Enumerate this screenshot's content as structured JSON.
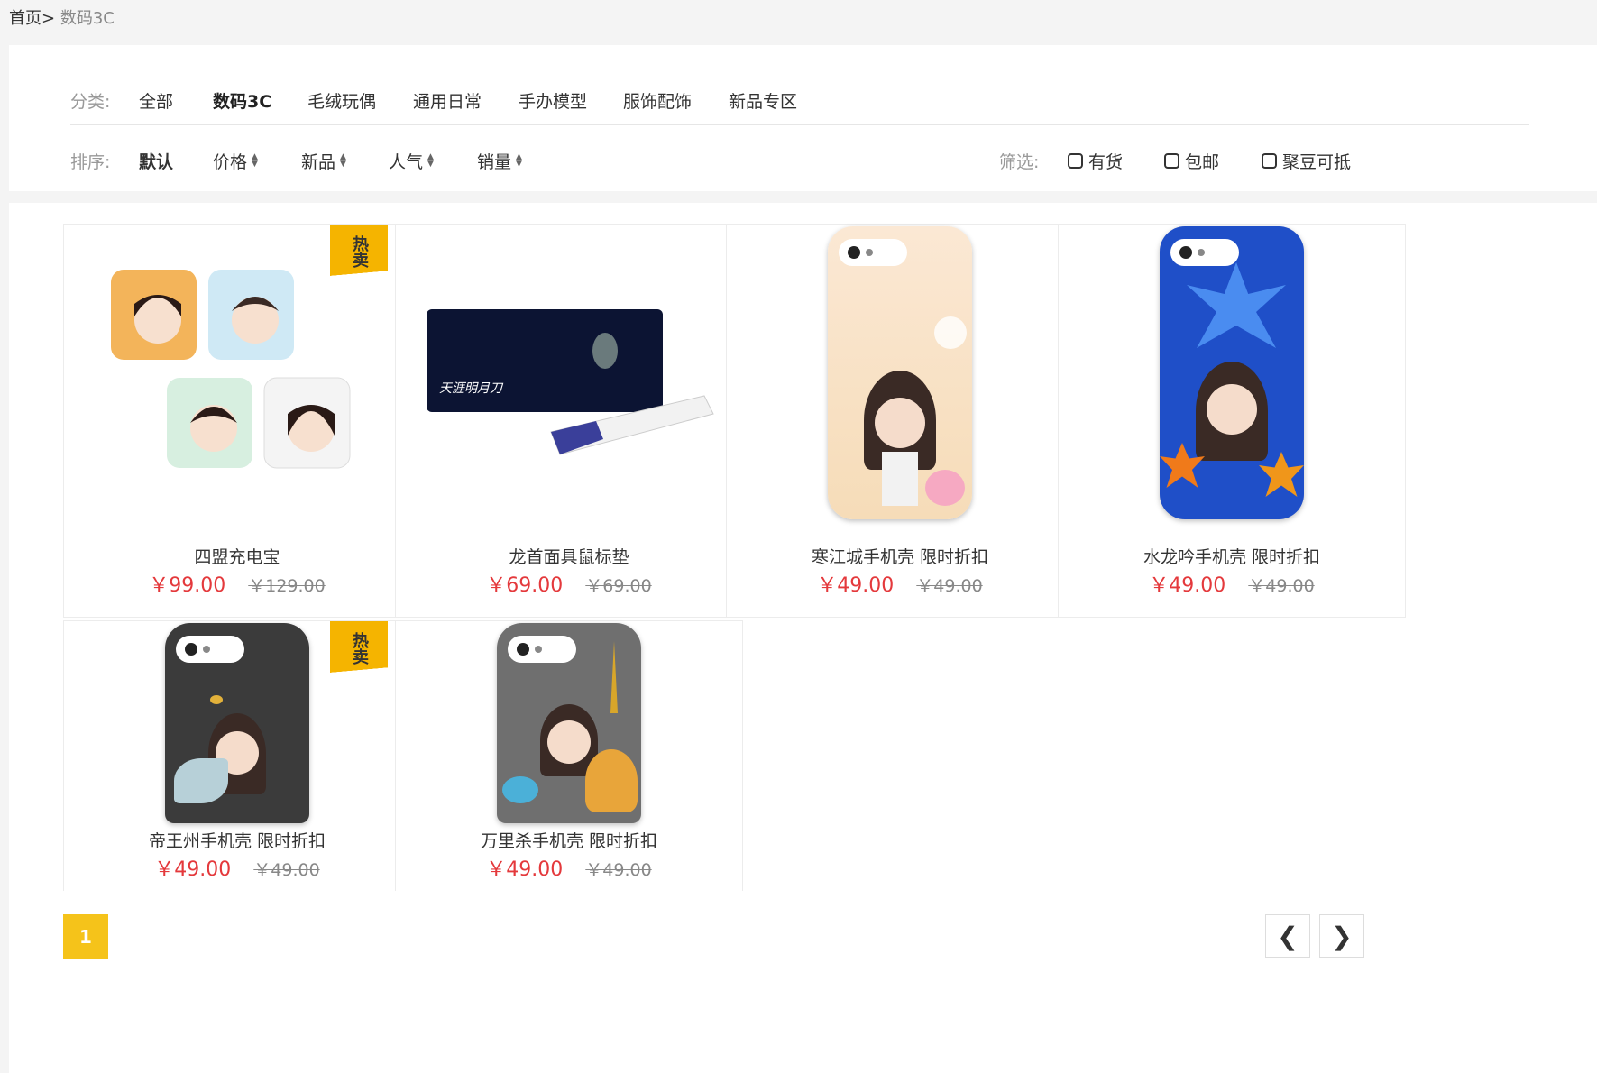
{
  "breadcrumb": {
    "home": "首页>",
    "current": "数码3C"
  },
  "filters": {
    "category_label": "分类:",
    "categories": [
      "全部",
      "数码3C",
      "毛绒玩偶",
      "通用日常",
      "手办模型",
      "服饰配饰",
      "新品专区"
    ],
    "active_category": "数码3C",
    "sort_label": "排序:",
    "sorts": [
      "默认",
      "价格",
      "新品",
      "人气",
      "销量"
    ],
    "active_sort": "默认",
    "sift_label": "筛选:",
    "checkboxes": [
      "有货",
      "包邮",
      "聚豆可抵"
    ]
  },
  "hot_label": "热卖",
  "products": [
    {
      "name": "四盟充电宝",
      "price": "￥99.00",
      "old_price": "￥129.00",
      "hot": true
    },
    {
      "name": "龙首面具鼠标垫",
      "price": "￥69.00",
      "old_price": "￥69.00",
      "hot": false
    },
    {
      "name": "寒江城手机壳 限时折扣",
      "price": "￥49.00",
      "old_price": "￥49.00",
      "hot": false
    },
    {
      "name": "水龙吟手机壳 限时折扣",
      "price": "￥49.00",
      "old_price": "￥49.00",
      "hot": false
    },
    {
      "name": "帝王州手机壳 限时折扣",
      "price": "￥49.00",
      "old_price": "￥49.00",
      "hot": true
    },
    {
      "name": "万里杀手机壳 限时折扣",
      "price": "￥49.00",
      "old_price": "￥49.00",
      "hot": false
    }
  ],
  "pager": {
    "current": "1",
    "prev_icon": "chevron-left-icon",
    "next_icon": "chevron-right-icon"
  },
  "colors": {
    "accent": "#f5c31a",
    "price": "#e4393c",
    "hot_badge": "#f5b400"
  }
}
